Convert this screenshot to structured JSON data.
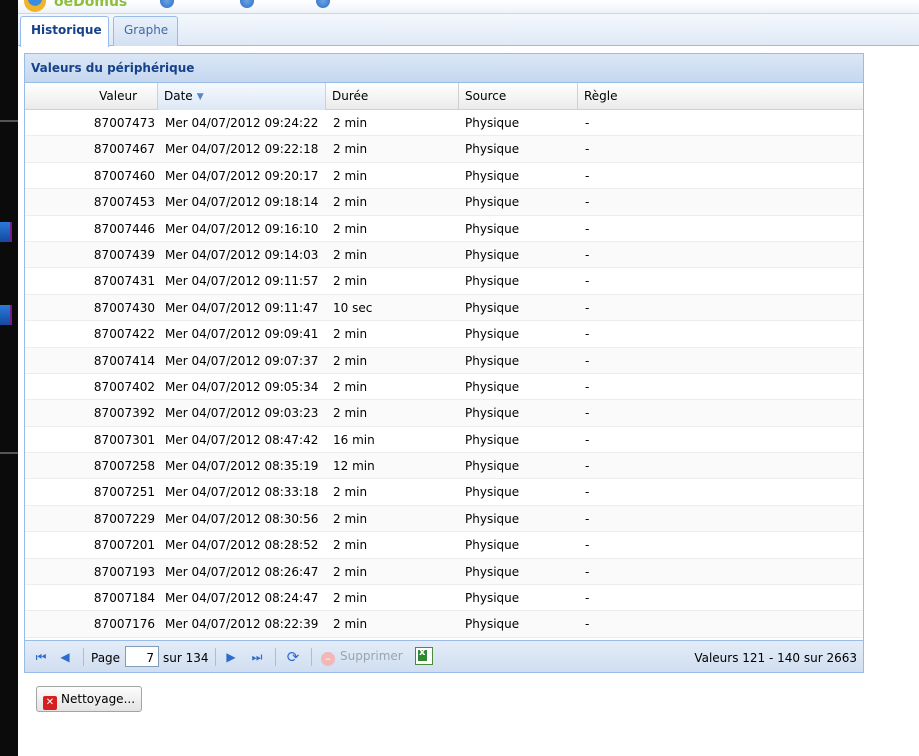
{
  "app": {
    "logo_text": "oeDomus"
  },
  "tabs": [
    {
      "label": "Historique",
      "active": true
    },
    {
      "label": "Graphe",
      "active": false
    }
  ],
  "panel": {
    "title": "Valeurs du périphérique"
  },
  "grid": {
    "columns": [
      {
        "label": "Valeur"
      },
      {
        "label": "Date",
        "sorted": "desc"
      },
      {
        "label": "Durée"
      },
      {
        "label": "Source"
      },
      {
        "label": "Règle"
      }
    ],
    "rows": [
      {
        "valeur": "87007473",
        "date": "Mer 04/07/2012 09:24:22",
        "duree": "2 min",
        "source": "Physique",
        "regle": "-"
      },
      {
        "valeur": "87007467",
        "date": "Mer 04/07/2012 09:22:18",
        "duree": "2 min",
        "source": "Physique",
        "regle": "-"
      },
      {
        "valeur": "87007460",
        "date": "Mer 04/07/2012 09:20:17",
        "duree": "2 min",
        "source": "Physique",
        "regle": "-"
      },
      {
        "valeur": "87007453",
        "date": "Mer 04/07/2012 09:18:14",
        "duree": "2 min",
        "source": "Physique",
        "regle": "-"
      },
      {
        "valeur": "87007446",
        "date": "Mer 04/07/2012 09:16:10",
        "duree": "2 min",
        "source": "Physique",
        "regle": "-"
      },
      {
        "valeur": "87007439",
        "date": "Mer 04/07/2012 09:14:03",
        "duree": "2 min",
        "source": "Physique",
        "regle": "-"
      },
      {
        "valeur": "87007431",
        "date": "Mer 04/07/2012 09:11:57",
        "duree": "2 min",
        "source": "Physique",
        "regle": "-"
      },
      {
        "valeur": "87007430",
        "date": "Mer 04/07/2012 09:11:47",
        "duree": "10 sec",
        "source": "Physique",
        "regle": "-"
      },
      {
        "valeur": "87007422",
        "date": "Mer 04/07/2012 09:09:41",
        "duree": "2 min",
        "source": "Physique",
        "regle": "-"
      },
      {
        "valeur": "87007414",
        "date": "Mer 04/07/2012 09:07:37",
        "duree": "2 min",
        "source": "Physique",
        "regle": "-"
      },
      {
        "valeur": "87007402",
        "date": "Mer 04/07/2012 09:05:34",
        "duree": "2 min",
        "source": "Physique",
        "regle": "-"
      },
      {
        "valeur": "87007392",
        "date": "Mer 04/07/2012 09:03:23",
        "duree": "2 min",
        "source": "Physique",
        "regle": "-"
      },
      {
        "valeur": "87007301",
        "date": "Mer 04/07/2012 08:47:42",
        "duree": "16 min",
        "source": "Physique",
        "regle": "-"
      },
      {
        "valeur": "87007258",
        "date": "Mer 04/07/2012 08:35:19",
        "duree": "12 min",
        "source": "Physique",
        "regle": "-"
      },
      {
        "valeur": "87007251",
        "date": "Mer 04/07/2012 08:33:18",
        "duree": "2 min",
        "source": "Physique",
        "regle": "-"
      },
      {
        "valeur": "87007229",
        "date": "Mer 04/07/2012 08:30:56",
        "duree": "2 min",
        "source": "Physique",
        "regle": "-"
      },
      {
        "valeur": "87007201",
        "date": "Mer 04/07/2012 08:28:52",
        "duree": "2 min",
        "source": "Physique",
        "regle": "-"
      },
      {
        "valeur": "87007193",
        "date": "Mer 04/07/2012 08:26:47",
        "duree": "2 min",
        "source": "Physique",
        "regle": "-"
      },
      {
        "valeur": "87007184",
        "date": "Mer 04/07/2012 08:24:47",
        "duree": "2 min",
        "source": "Physique",
        "regle": "-"
      },
      {
        "valeur": "87007176",
        "date": "Mer 04/07/2012 08:22:39",
        "duree": "2 min",
        "source": "Physique",
        "regle": "-"
      }
    ]
  },
  "pager": {
    "page_label": "Page",
    "page_value": "7",
    "of_label": "sur 134",
    "delete_label": "Supprimer",
    "status": "Valeurs  121 - 140 sur 2663"
  },
  "actions": {
    "clean_label": "Nettoyage..."
  },
  "colors": {
    "accent": "#15428b",
    "border": "#99bbe8",
    "icon_blue": "#2d6ccd"
  }
}
